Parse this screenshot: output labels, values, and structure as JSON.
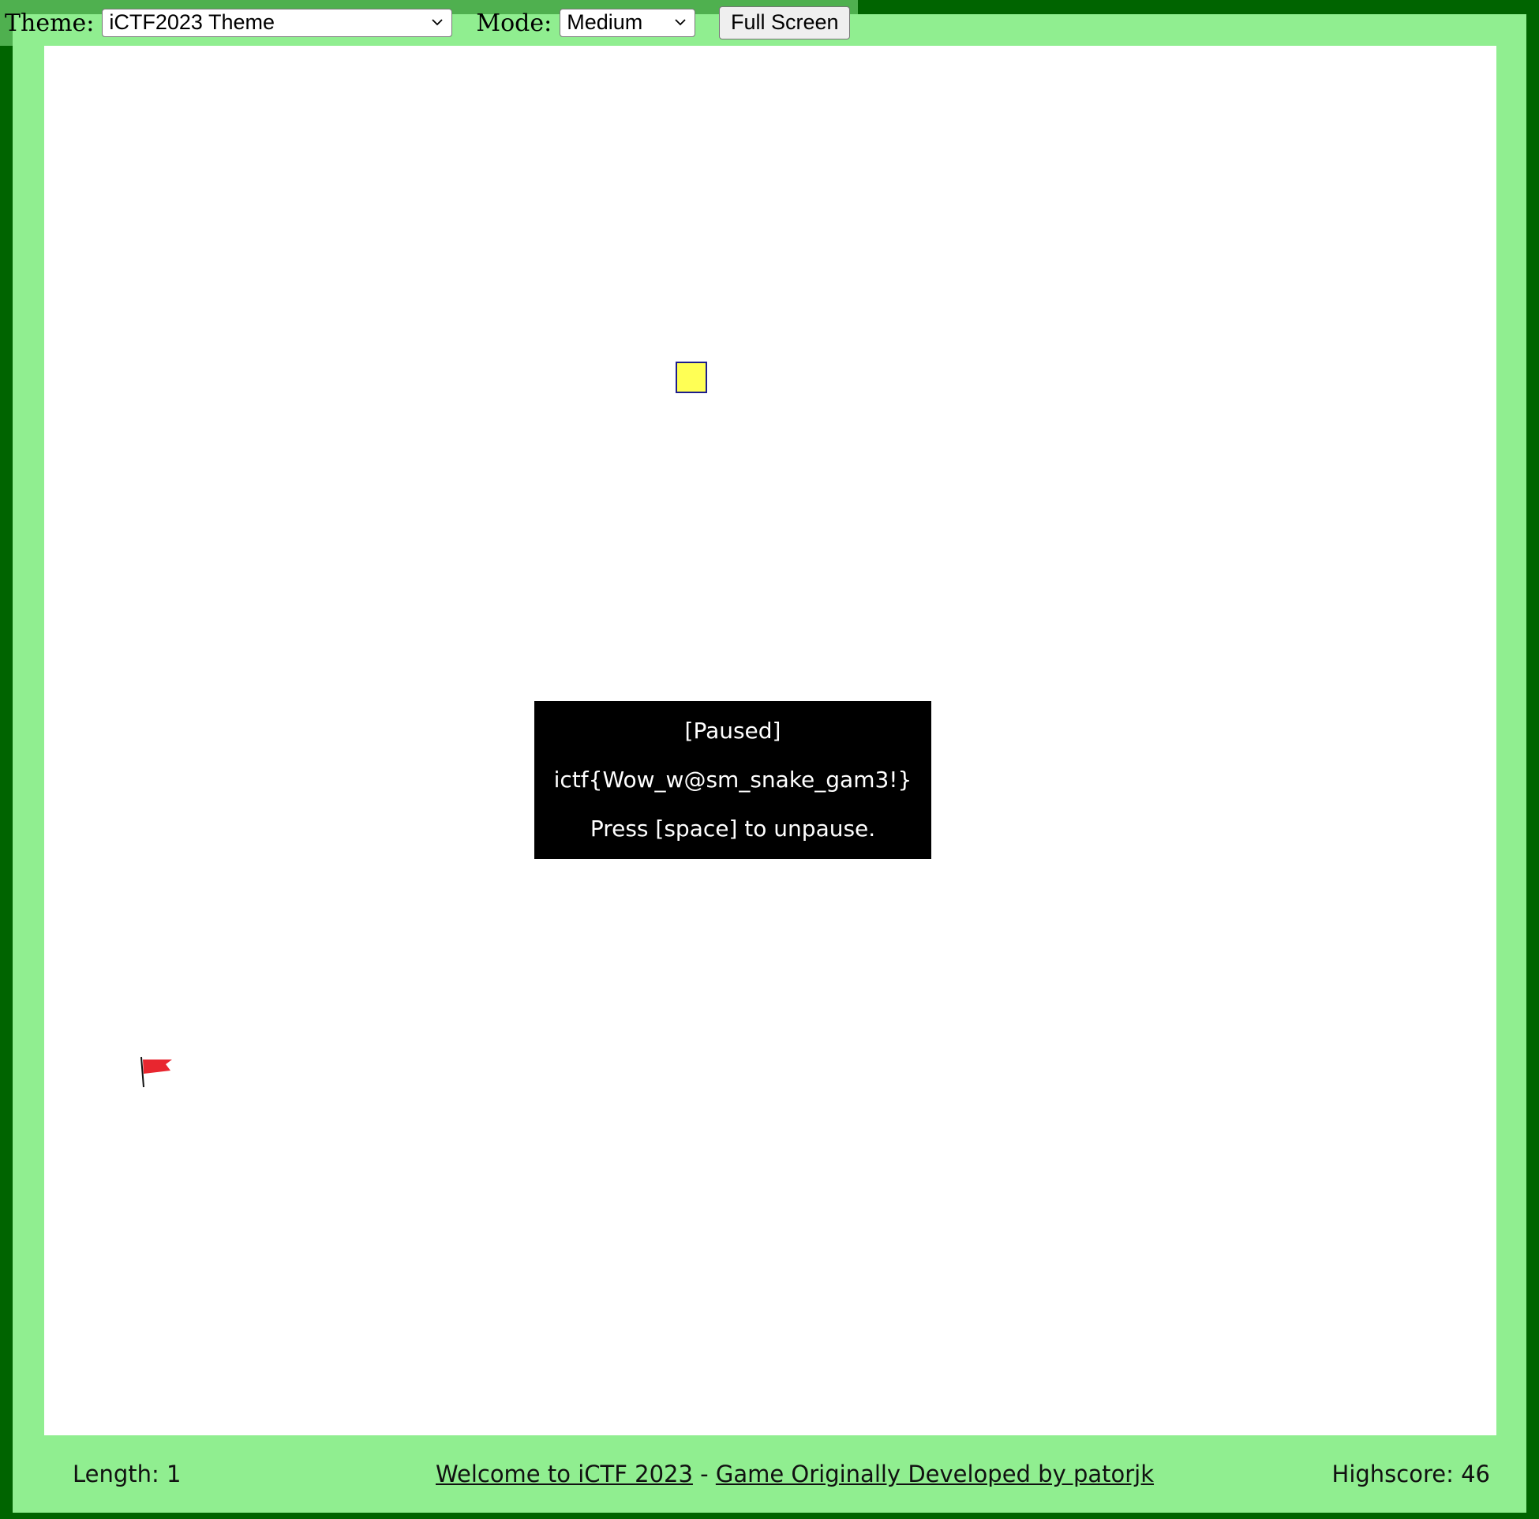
{
  "controls": {
    "theme_label": "Theme:",
    "theme_value": "iCTF2023 Theme",
    "mode_label": "Mode:",
    "mode_value": "Medium",
    "fullscreen_label": "Full Screen"
  },
  "colors": {
    "outer_border": "#006400",
    "frame": "#90ee90",
    "playfield": "#ffffff",
    "snake_head_fill": "#ffff55",
    "snake_head_border": "#1c1c8c",
    "food_flag": "#e8262f",
    "pause_box": "#000000"
  },
  "game": {
    "snake_icon": "snake-head-square",
    "food_icon": "red-flag-icon"
  },
  "pause": {
    "title": "[Paused]",
    "flag": "ictf{Wow_w@sm_snake_gam3!}",
    "hint": "Press [space] to unpause."
  },
  "footer": {
    "length_text": "Length: 1",
    "welcome_link": "Welcome to iCTF 2023",
    "separator": " - ",
    "credit_link": "Game Originally Developed by patorjk",
    "highscore_text": "Highscore: 46"
  }
}
